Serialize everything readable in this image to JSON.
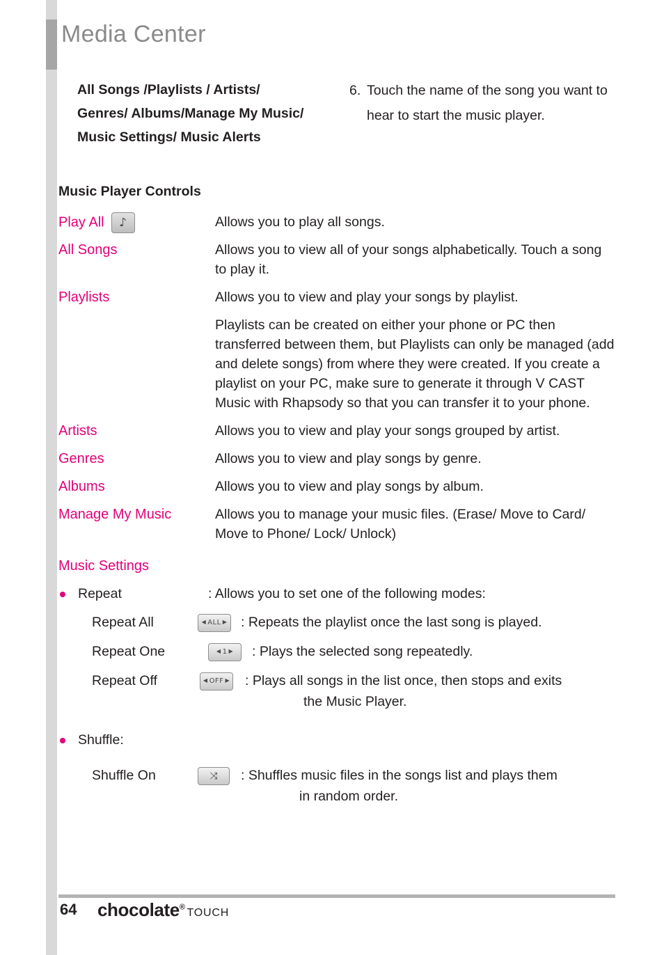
{
  "header": {
    "title": "Media Center"
  },
  "intro": {
    "left_heading": "All Songs /Playlists / Artists/ Genres/ Albums/Manage My Music/ Music Settings/ Music Alerts",
    "step_number": "6.",
    "step_text": "Touch the name of the song you want to hear to start the music player."
  },
  "section": {
    "heading": "Music Player Controls"
  },
  "entries": [
    {
      "term": "Play All",
      "icon": "music-note-key-icon",
      "icon_label": "♪",
      "desc": "Allows you to play all songs."
    },
    {
      "term": "All Songs",
      "desc": "Allows you to view all of your songs alphabetically. Touch a song to play it."
    },
    {
      "term": "Playlists",
      "desc": "Allows you to view and play your songs by playlist.",
      "desc2": "Playlists can be created on either your phone or PC then transferred between them, but Playlists can only be managed (add and delete songs) from where they were created.  If you create a playlist on your PC, make sure to generate it through V CAST Music with Rhapsody so that you can transfer it to your phone."
    },
    {
      "term": "Artists",
      "desc": "Allows you to view and play your songs grouped by artist."
    },
    {
      "term": "Genres",
      "desc": "Allows you to view and play songs by genre."
    },
    {
      "term": "Albums",
      "desc": "Allows you to view and play songs by album."
    },
    {
      "term": "Manage My Music",
      "desc": "Allows you to manage your music files. (Erase/ Move to Card/ Move to Phone/ Lock/ Unlock)"
    }
  ],
  "music_settings": {
    "heading": "Music Settings",
    "repeat": {
      "label": "Repeat",
      "desc": ": Allows you to set one of the following modes:",
      "items": [
        {
          "label": "Repeat All",
          "icon": "repeat-all-key-icon",
          "icon_label": "ALL",
          "desc": ": Repeats the playlist once the last song is played."
        },
        {
          "label": "Repeat One",
          "icon": "repeat-one-key-icon",
          "icon_label": "1",
          "desc": ": Plays the selected song repeatedly."
        },
        {
          "label": "Repeat Off",
          "icon": "repeat-off-key-icon",
          "icon_label": "OFF",
          "desc": ": Plays all songs in the list once, then stops and exits",
          "desc_cont": "the Music Player."
        }
      ]
    },
    "shuffle": {
      "label": "Shuffle:",
      "items": [
        {
          "label": "Shuffle On",
          "icon": "shuffle-key-icon",
          "icon_label": "⤨",
          "desc": ": Shuffles music files in the songs list and plays them",
          "desc_cont": "in random order."
        }
      ]
    }
  },
  "footer": {
    "page_number": "64",
    "brand": "chocolate",
    "brand_mark": "®",
    "brand_suffix": "TOUCH"
  },
  "colors": {
    "accent": "#e2007a",
    "title_gray": "#8a8a8a",
    "bar_gray": "#d9d9d9"
  }
}
